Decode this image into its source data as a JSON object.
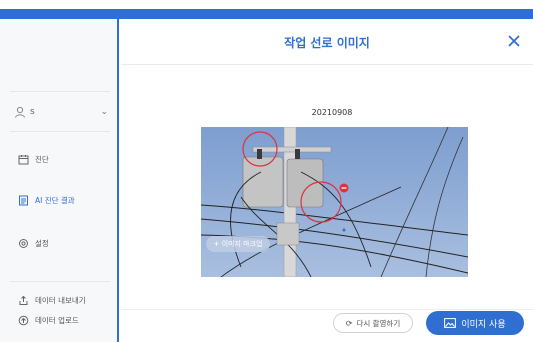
{
  "sidebar": {
    "user": {
      "name": "s",
      "icon": "user-icon"
    },
    "items": [
      {
        "label": "진단",
        "icon": "calendar-icon"
      },
      {
        "label": "AI 진단 결과",
        "icon": "document-icon",
        "active": true
      },
      {
        "label": "설정",
        "icon": "gear-icon"
      }
    ],
    "bottom": [
      {
        "label": "데이터 내보내기",
        "icon": "export-icon"
      },
      {
        "label": "데이터 업로드",
        "icon": "upload-icon"
      }
    ]
  },
  "dialog": {
    "title": "작업 선로 이미지",
    "date": "20210908",
    "markup_label": "+ 이미지 마크업",
    "retake_label": "다시 촬영하기",
    "use_label": "이미지 사용"
  },
  "colors": {
    "accent": "#2f6fd1",
    "marker_red": "#e0303a"
  }
}
